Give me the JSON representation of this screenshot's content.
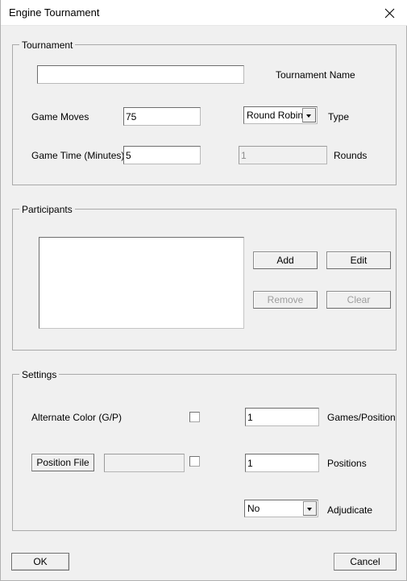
{
  "window": {
    "title": "Engine Tournament",
    "close_icon": "close-icon"
  },
  "tournament": {
    "legend": "Tournament",
    "name_label": "Tournament Name",
    "name_value": "",
    "name_placeholder": "",
    "game_moves_label": "Game Moves",
    "game_moves_value": "75",
    "game_time_label": "Game Time (Minutes)",
    "game_time_value": "5",
    "type_label": "Type",
    "type_value": "Round Robin",
    "type_options": [
      "Round Robin"
    ],
    "rounds_label": "Rounds",
    "rounds_value": "1"
  },
  "participants": {
    "legend": "Participants",
    "list_items": [],
    "add_label": "Add",
    "edit_label": "Edit",
    "remove_label": "Remove",
    "clear_label": "Clear"
  },
  "settings": {
    "legend": "Settings",
    "alternate_color_label": "Alternate Color (G/P)",
    "alternate_color_checked": false,
    "games_position_label": "Games/Position",
    "games_position_value": "1",
    "position_file_label": "Position File",
    "position_file_value": "",
    "position_file_checked": false,
    "positions_label": "Positions",
    "positions_value": "1",
    "adjudicate_label": "Adjudicate",
    "adjudicate_value": "No",
    "adjudicate_options": [
      "No"
    ]
  },
  "footer": {
    "ok_label": "OK",
    "cancel_label": "Cancel"
  },
  "colors": {
    "window_bg": "#f0f0f0",
    "titlebar_bg": "#ffffff",
    "border": "#a9a9a9",
    "field_bg": "#ffffff",
    "disabled_text": "#8d8d8d"
  }
}
